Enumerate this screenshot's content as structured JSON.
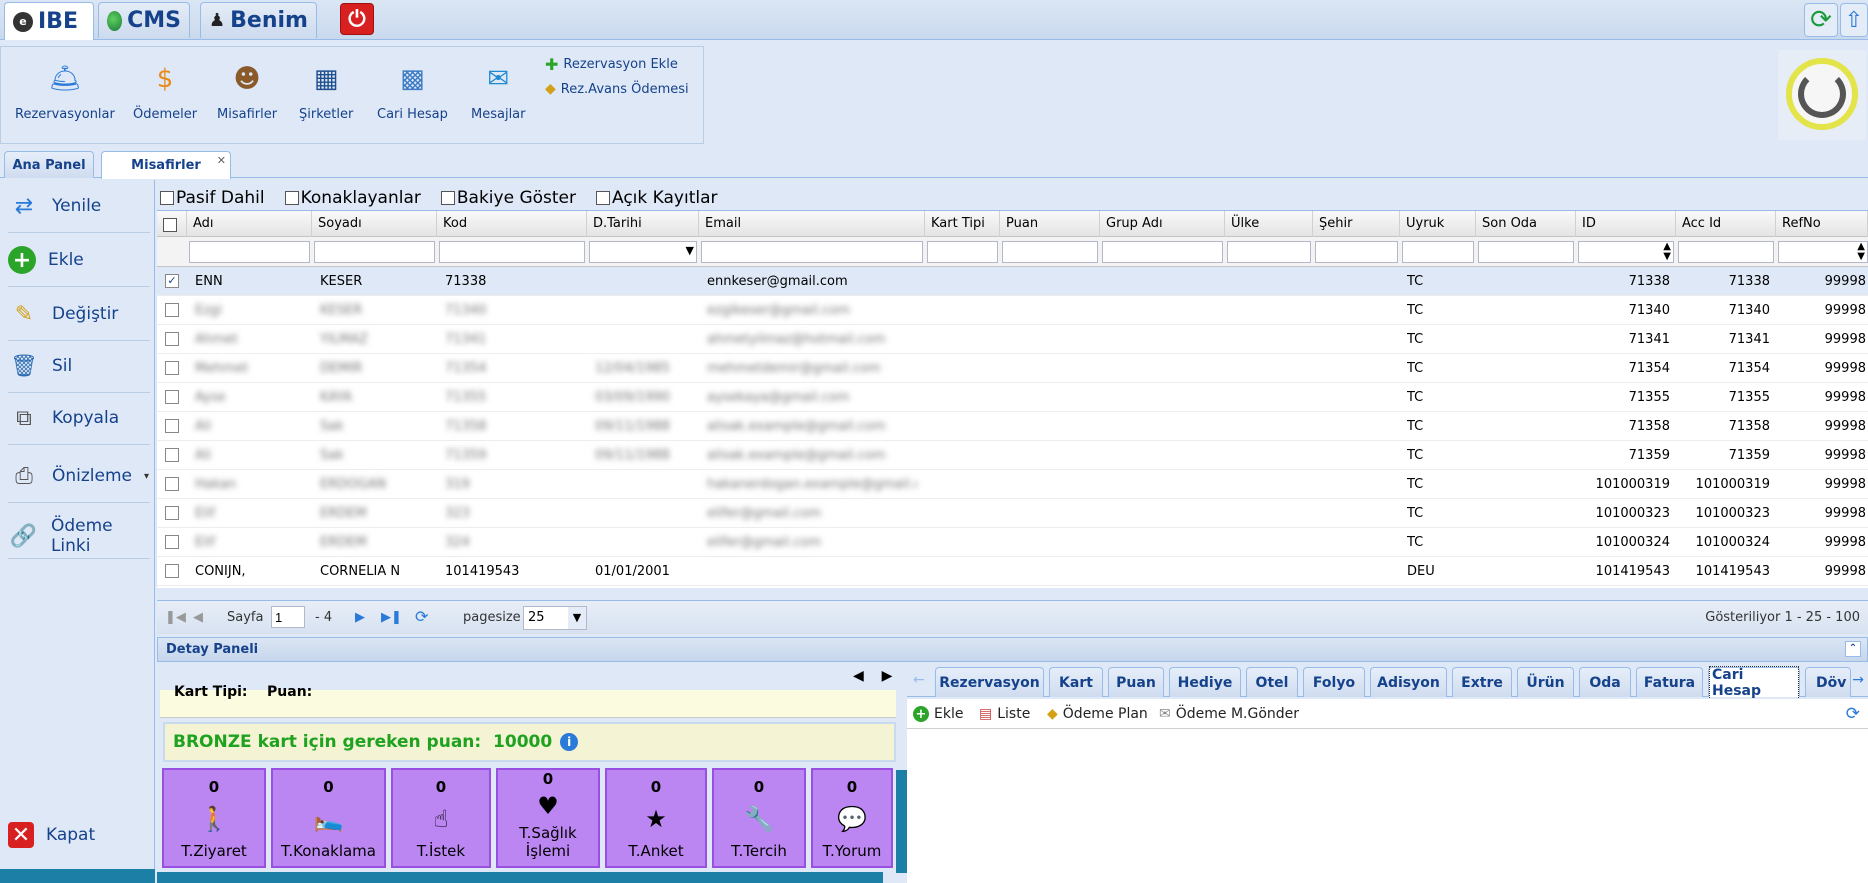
{
  "app": {
    "tabs": [
      {
        "label": "IBE",
        "icon": "ibe-logo-icon"
      },
      {
        "label": "CMS",
        "icon": "globe-icon"
      },
      {
        "label": "Benim",
        "icon": "user-icon"
      }
    ]
  },
  "ribbon": {
    "items": [
      "Rezervasyonlar",
      "Ödemeler",
      "Misafirler",
      "Şirketler",
      "Cari Hesap",
      "Mesajlar"
    ],
    "links": [
      "Rezervasyon Ekle",
      "Rez.Avans Ödemesi"
    ]
  },
  "page_tabs": {
    "home": "Ana Panel",
    "current": "Misafirler"
  },
  "sidebar": {
    "items": [
      "Yenile",
      "Ekle",
      "Değiştir",
      "Sil",
      "Kopyala",
      "Önizleme",
      "Ödeme Linki"
    ],
    "close": "Kapat"
  },
  "filters": [
    "Pasif Dahil",
    "Konaklayanlar",
    "Bakiye Göster",
    "Açık Kayıtlar"
  ],
  "grid": {
    "columns": [
      "Adı",
      "Soyadı",
      "Kod",
      "D.Tarihi",
      "Email",
      "Kart Tipi",
      "Puan",
      "Grup Adı",
      "Ülke",
      "Şehir",
      "Uyruk",
      "Son Oda",
      "ID",
      "Acc Id",
      "RefNo"
    ],
    "rows": [
      {
        "name": "ENN",
        "surname": "KESER",
        "code": "71338",
        "dob": "",
        "email": "ennkeser@gmail.com",
        "nat": "TC",
        "id": "71338",
        "acc": "71338",
        "ref": "99998",
        "blur": false,
        "checked": true
      },
      {
        "name": "Ezgi",
        "surname": "KESER",
        "code": "71340",
        "dob": "",
        "email": "ezgikeser@gmail.com",
        "nat": "TC",
        "id": "71340",
        "acc": "71340",
        "ref": "99998",
        "blur": true
      },
      {
        "name": "Ahmet",
        "surname": "YILMAZ",
        "code": "71341",
        "dob": "",
        "email": "ahmetyilmaz@hotmail.com",
        "nat": "TC",
        "id": "71341",
        "acc": "71341",
        "ref": "99998",
        "blur": true
      },
      {
        "name": "Mehmet",
        "surname": "DEMIR",
        "code": "71354",
        "dob": "12/04/1985",
        "email": "mehmetdemir@gmail.com",
        "nat": "TC",
        "id": "71354",
        "acc": "71354",
        "ref": "99998",
        "blur": true
      },
      {
        "name": "Ayse",
        "surname": "KAYA",
        "code": "71355",
        "dob": "03/09/1990",
        "email": "aysekaya@gmail.com",
        "nat": "TC",
        "id": "71355",
        "acc": "71355",
        "ref": "99998",
        "blur": true
      },
      {
        "name": "Ali",
        "surname": "Sak",
        "code": "71358",
        "dob": "09/11/1988",
        "email": "alisak.example@gmail.com",
        "nat": "TC",
        "id": "71358",
        "acc": "71358",
        "ref": "99998",
        "blur": true
      },
      {
        "name": "Ali",
        "surname": "Sak",
        "code": "71359",
        "dob": "09/11/1988",
        "email": "alisak.example@gmail.com",
        "nat": "TC",
        "id": "71359",
        "acc": "71359",
        "ref": "99998",
        "blur": true
      },
      {
        "name": "Hakan",
        "surname": "ERDOGAN",
        "code": "319",
        "dob": "",
        "email": "hakanerdogan.example@gmail.com",
        "nat": "TC",
        "id": "101000319",
        "acc": "101000319",
        "ref": "99998",
        "blur": true
      },
      {
        "name": "Elif",
        "surname": "ERDEM",
        "code": "323",
        "dob": "",
        "email": "elifer@gmail.com",
        "nat": "TC",
        "id": "101000323",
        "acc": "101000323",
        "ref": "99998",
        "blur": true
      },
      {
        "name": "Elif",
        "surname": "ERDEM",
        "code": "324",
        "dob": "",
        "email": "elifer@gmail.com",
        "nat": "TC",
        "id": "101000324",
        "acc": "101000324",
        "ref": "99998",
        "blur": true
      },
      {
        "name": "CONIJN,",
        "surname": "CORNELIA N",
        "code": "101419543",
        "dob": "01/01/2001",
        "email": "",
        "nat": "DEU",
        "id": "101419543",
        "acc": "101419543",
        "ref": "99998",
        "blur": false
      }
    ]
  },
  "paging": {
    "page_label": "Sayfa",
    "page": "1",
    "of": "- 4",
    "pagesize_label": "pagesize",
    "pagesize": "25",
    "status": "Gösteriliyor 1 - 25 - 100"
  },
  "detail": {
    "title": "Detay Paneli",
    "kart_line": "Kart Tipi:    Puan:",
    "bronze_text": "BRONZE kart için gereken puan:  10000",
    "tiles": [
      {
        "value": "0",
        "label": "T.Ziyaret",
        "icon": "walking-icon"
      },
      {
        "value": "0",
        "label": "T.Konaklama",
        "icon": "bed-icon"
      },
      {
        "value": "0",
        "label": "T.İstek",
        "icon": "hand-pointer-icon"
      },
      {
        "value": "0",
        "label": "T.Sağlık İşlemi",
        "icon": "heartbeat-icon"
      },
      {
        "value": "0",
        "label": "T.Anket",
        "icon": "star-icon"
      },
      {
        "value": "0",
        "label": "T.Tercih",
        "icon": "wrench-icon"
      },
      {
        "value": "0",
        "label": "T.Yorum",
        "icon": "comment-icon"
      }
    ],
    "tabs": [
      "Rezervasyon",
      "Kart",
      "Puan",
      "Hediye",
      "Otel",
      "Folyo",
      "Adisyon",
      "Extre",
      "Ürün",
      "Oda",
      "Fatura",
      "Cari Hesap",
      "Döv"
    ],
    "active_tab": "Cari Hesap",
    "toolbar": [
      "Ekle",
      "Liste",
      "Ödeme Plan",
      "Ödeme M.Gönder"
    ]
  }
}
